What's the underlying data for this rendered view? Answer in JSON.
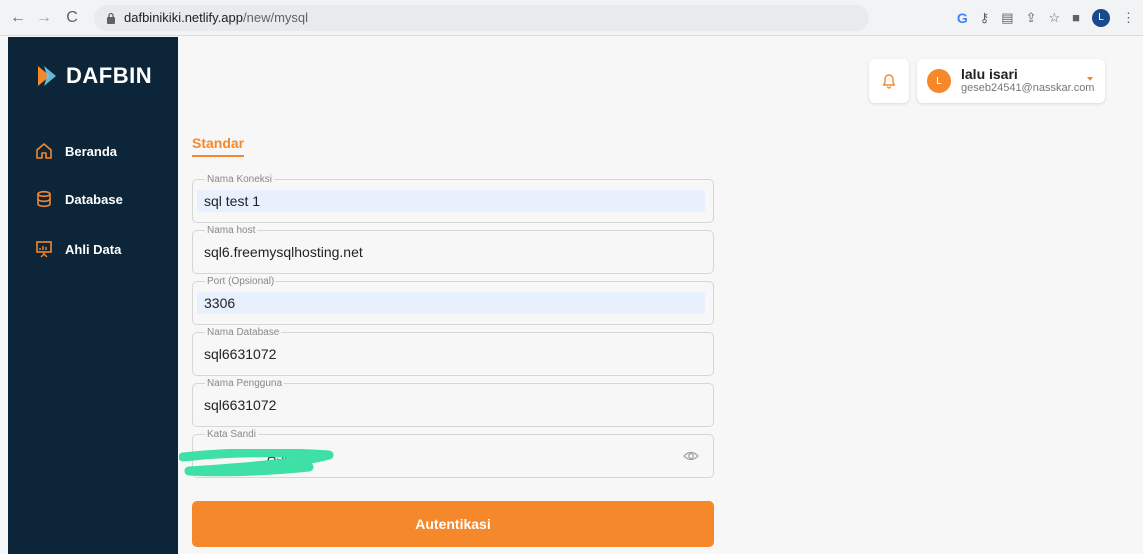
{
  "browser": {
    "url_domain": "dafbinikiki.netlify.app",
    "url_path": "/new/mysql",
    "profile_initial": "L",
    "google_icon": "G"
  },
  "sidebar": {
    "brand": "DAFBIN",
    "items": [
      {
        "label": "Beranda",
        "icon": "home-icon"
      },
      {
        "label": "Database",
        "icon": "database-icon"
      },
      {
        "label": "Ahli Data",
        "icon": "presentation-icon"
      }
    ]
  },
  "header": {
    "user_initial": "L",
    "user_name": "lalu isari",
    "user_email": "geseb24541@nasskar.com"
  },
  "tabs": {
    "active": "Standar"
  },
  "form": {
    "fields": [
      {
        "label": "Nama Koneksi",
        "value": "sql test 1"
      },
      {
        "label": "Nama host",
        "value": "sql6.freemysqlhosting.net"
      },
      {
        "label": "Port (Opsional)",
        "value": "3306"
      },
      {
        "label": "Nama Database",
        "value": "sql6631072"
      },
      {
        "label": "Nama Pengguna",
        "value": "sql6631072"
      },
      {
        "label": "Kata Sandi",
        "value": "A5FLe"
      }
    ],
    "submit_label": "Autentikasi"
  },
  "colors": {
    "accent": "#f5882a",
    "sidebar_bg": "#0c2538",
    "redaction": "#3fe0a5"
  }
}
